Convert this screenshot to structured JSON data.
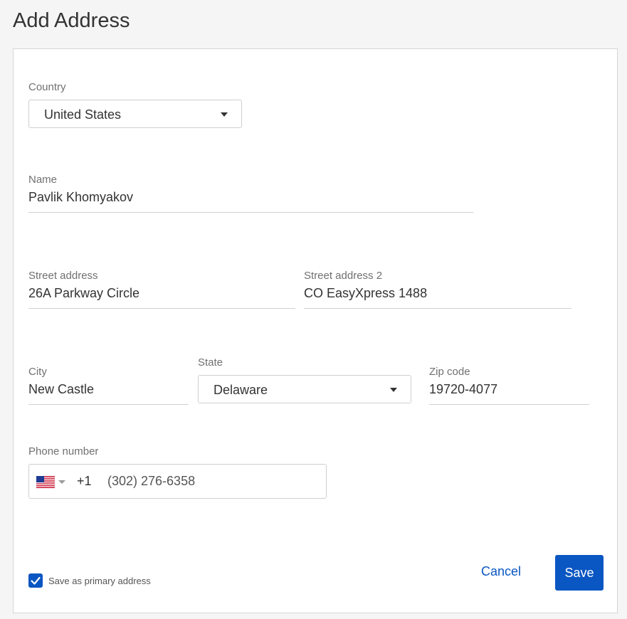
{
  "page": {
    "title": "Add Address"
  },
  "country": {
    "label": "Country",
    "value": "United States"
  },
  "name": {
    "label": "Name",
    "value": "Pavlik Khomyakov"
  },
  "street1": {
    "label": "Street address",
    "value": "26A Parkway Circle"
  },
  "street2": {
    "label": "Street address 2",
    "value": "CO EasyXpress 1488"
  },
  "city": {
    "label": "City",
    "value": "New Castle"
  },
  "state": {
    "label": "State",
    "value": "Delaware"
  },
  "zip": {
    "label": "Zip code",
    "value": "19720-4077"
  },
  "phone": {
    "label": "Phone number",
    "dial_code": "+1",
    "value": "(302) 276-6358",
    "flag": "us-flag-icon"
  },
  "primary": {
    "label": "Save as primary address",
    "checked": true
  },
  "actions": {
    "cancel_label": "Cancel",
    "save_label": "Save"
  },
  "colors": {
    "accent": "#0a56c2",
    "label_gray": "#707070",
    "text": "#333333"
  }
}
